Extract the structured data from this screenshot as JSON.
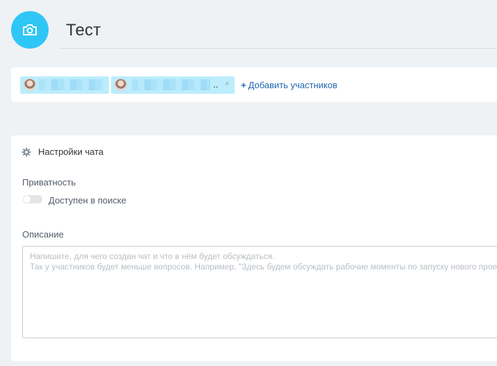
{
  "header": {
    "title": "Тест",
    "avatar_icon": "camera-icon",
    "avatar_color": "#2fc6f6"
  },
  "members": {
    "items": [
      {
        "name_visibility": "blurred",
        "truncated": false,
        "removable": false
      },
      {
        "name_visibility": "blurred",
        "truncated": true,
        "truncation_label": "..",
        "remove_label": "×",
        "removable": true
      }
    ],
    "add_label": "Добавить участников",
    "add_icon": "plus-icon"
  },
  "settings": {
    "title": "Настройки чата",
    "icon": "gear-icon",
    "privacy_label": "Приватность",
    "toggle_label": "Доступен в поиске",
    "toggle_on": false,
    "description_label": "Описание",
    "description_value": "",
    "description_placeholder_line1": "Напишите, для чего создан чат и что в нём будет обсуждаться.",
    "description_placeholder_line2": "Так у участников будет меньше вопросов. Например, \"Здесь будем обсуждать рабочие моменты по запуску нового проекта\""
  },
  "colors": {
    "background": "#eef2f4",
    "chip": "#bcedfc",
    "link": "#2067b0"
  }
}
